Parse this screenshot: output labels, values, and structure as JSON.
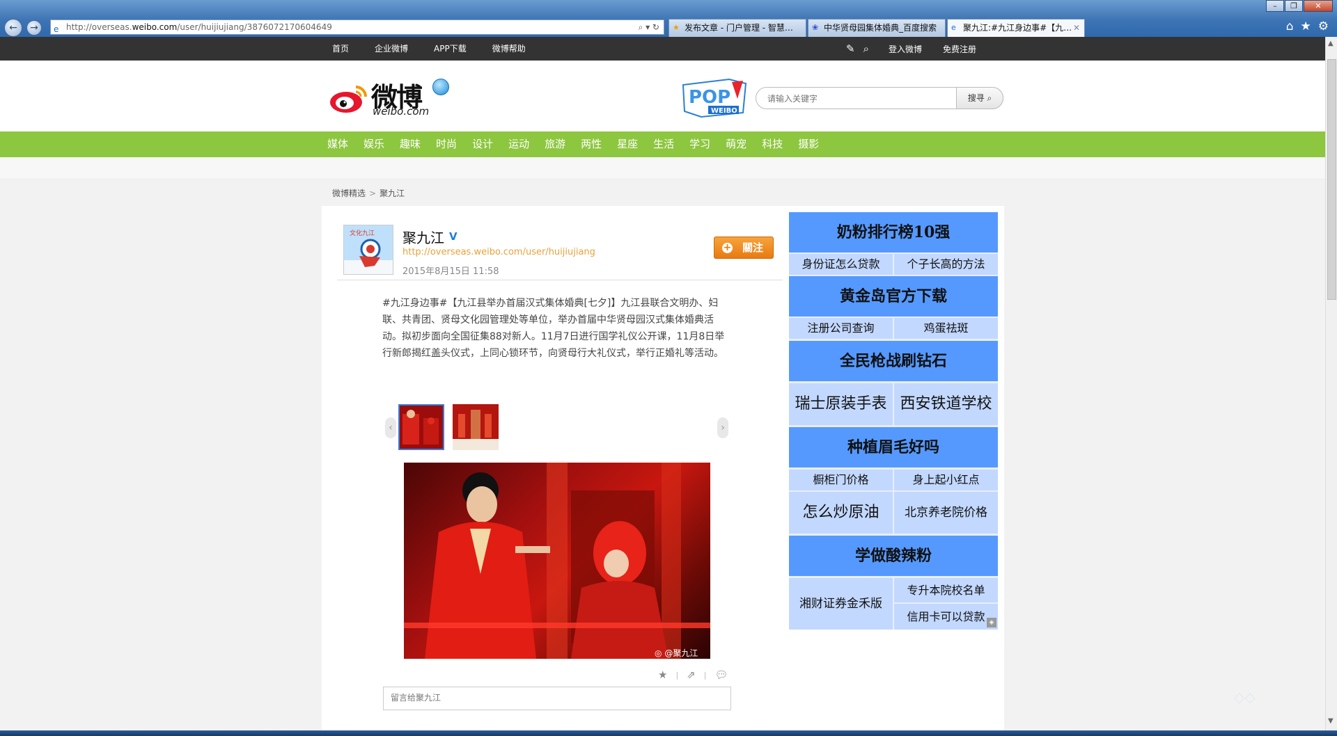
{
  "browser": {
    "address": "http://overseas.weibo.com/user/huijiujiang/3876072170604649",
    "address_prefix": "http://overseas.",
    "address_domain": "weibo.com",
    "address_suffix": "/user/huijiujiang/3876072170604649",
    "tabs": [
      {
        "label": "发布文章 - 门户管理 - 智慧…",
        "color": "#f3c13a"
      },
      {
        "label": "中华贤母园集体婚典_百度搜索",
        "color": "#2f4fd0"
      },
      {
        "label": "聚九江:#九江身边事#【九…",
        "color": "#1f6fd1",
        "active": true
      }
    ]
  },
  "topnav": {
    "links": [
      "首页",
      "企业微博",
      "APP下载",
      "微博帮助"
    ],
    "login": "登入微博",
    "register": "免费注册"
  },
  "header": {
    "logo_text": "微博",
    "logo_sub": "weibo.com",
    "search_placeholder": "请输入关键字",
    "search_button": "搜寻"
  },
  "categories": [
    "媒体",
    "娱乐",
    "趣味",
    "时尚",
    "设计",
    "运动",
    "旅游",
    "两性",
    "星座",
    "生活",
    "学习",
    "萌宠",
    "科技",
    "摄影"
  ],
  "breadcrumb": [
    "微博精选",
    "聚九江"
  ],
  "post": {
    "user": "聚九江",
    "link": "http://overseas.weibo.com/user/huijiujiang",
    "date": "2015年8月15日 11:58",
    "follow": "關注",
    "text": "#九江身边事#【九江县举办首届汉式集体婚典[七夕]】九江县联合文明办、妇联、共青团、贤母文化园管理处等单位，举办首届中华贤母园汉式集体婚典活动。拟初步面向全国征集88对新人。11月7日进行国学礼仪公开课，11月8日举行新郎揭红盖头仪式，上同心锁环节，向贤母行大礼仪式，举行正婚礼等活动。",
    "watermark": "@聚九江",
    "comment_placeholder": "留言给聚九江"
  },
  "ads": [
    {
      "text": "奶粉排行榜10强",
      "type": "big"
    },
    {
      "text": "身份证怎么贷款",
      "type": "small"
    },
    {
      "text": "个子长高的方法",
      "type": "small"
    },
    {
      "text": "黄金岛官方下载",
      "type": "big"
    },
    {
      "text": "注册公司查询",
      "type": "small"
    },
    {
      "text": "鸡蛋祛斑",
      "type": "small"
    },
    {
      "text": "全民枪战刷钻石",
      "type": "big"
    },
    {
      "text": "瑞士原装手表",
      "type": "med"
    },
    {
      "text": "西安铁道学校",
      "type": "med"
    },
    {
      "text": "种植眉毛好吗",
      "type": "big"
    },
    {
      "text": "橱柜门价格",
      "type": "small"
    },
    {
      "text": "身上起小红点",
      "type": "small"
    },
    {
      "text": "怎么炒原油",
      "type": "med"
    },
    {
      "text": "北京养老院价格",
      "type": "small"
    },
    {
      "text": "学做酸辣粉",
      "type": "big"
    },
    {
      "text": "湘财证券金禾版",
      "type": "small"
    },
    {
      "text": "专升本院校名单",
      "type": "small"
    },
    {
      "text": "信用卡可以贷款",
      "type": "small"
    }
  ],
  "colors": {
    "green_nav": "#8dc63f",
    "ad_blue": "#5599ff",
    "ad_light": "#c2d8ff",
    "follow_orange": "#f0901f"
  }
}
